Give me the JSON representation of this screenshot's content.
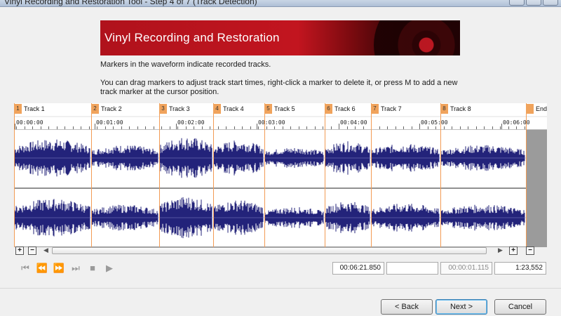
{
  "window": {
    "title": "Vinyl Recording and Restoration Tool - Step 4 of 7 (Track Detection)"
  },
  "banner": {
    "text": "Vinyl Recording and Restoration"
  },
  "instructions": {
    "line1": "Markers in the waveform indicate recorded tracks.",
    "line2": "You can drag markers to adjust track start times, right-click a marker to delete it, or press M to add a new track marker at the cursor position."
  },
  "markers": [
    {
      "num": "1",
      "label": "Track 1"
    },
    {
      "num": "2",
      "label": "Track 2"
    },
    {
      "num": "3",
      "label": "Track 3"
    },
    {
      "num": "4",
      "label": "Track 4"
    },
    {
      "num": "5",
      "label": "Track 5"
    },
    {
      "num": "6",
      "label": "Track 6"
    },
    {
      "num": "7",
      "label": "Track 7"
    },
    {
      "num": "8",
      "label": "Track 8"
    },
    {
      "num": "",
      "label": "End"
    }
  ],
  "ruler": {
    "labels": [
      "00:00:00",
      "00:01:00",
      "00:02:00",
      "00:03:00",
      "00:04:00",
      "00:05:00",
      "00:06:00"
    ]
  },
  "zoom": {
    "in_left": "+",
    "out_left": "−",
    "in_right": "+",
    "out_right": "−"
  },
  "transport": {
    "icons": [
      "skip-to-start-icon",
      "previous-track-icon",
      "next-track-icon",
      "skip-to-end-icon",
      "stop-icon",
      "play-icon"
    ],
    "glyphs": [
      "⏮",
      "⏪",
      "⏩",
      "⏭",
      "■",
      "▶"
    ]
  },
  "position": {
    "current_time": "00:06:21.850",
    "selection": "",
    "length": "00:00:01.115",
    "zoom_ratio": "1:23,552"
  },
  "buttons": {
    "back": "< Back",
    "next": "Next >",
    "cancel": "Cancel"
  },
  "colors": {
    "waveform": "#23237a",
    "marker": "#f29b54",
    "banner": "#b0121c"
  }
}
